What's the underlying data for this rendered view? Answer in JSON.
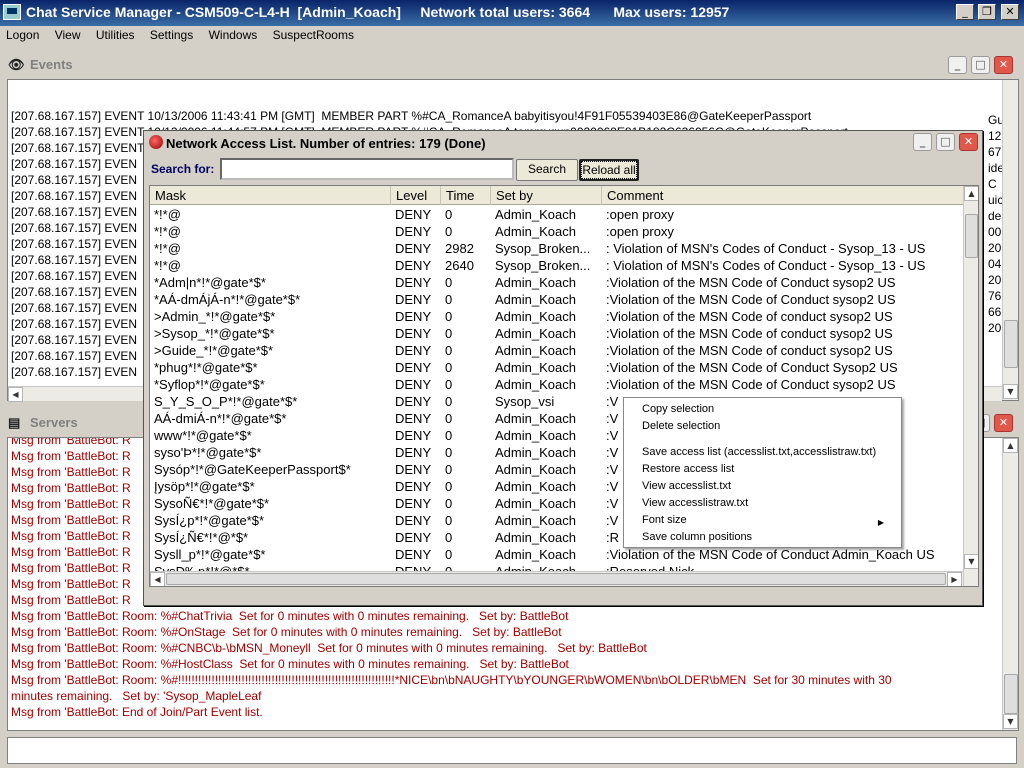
{
  "window": {
    "title": "Chat Service Manager - CSM509-C-L4-H  [Admin_Koach]     Network total users: 3664      Max users: 12957",
    "minimize": "_",
    "restore": "❐",
    "close": "✕"
  },
  "menu": [
    "Logon",
    "View",
    "Utilities",
    "Settings",
    "Windows",
    "SuspectRooms"
  ],
  "events": {
    "title": "Events",
    "lines": [
      "[207.68.167.157] EVENT 10/13/2006 11:43:41 PM [GMT]  MEMBER PART %#CA_RomanceA babyitisyou!4F91F05539403E86@GateKeeperPassport",
      "[207.68.167.157] EVENT 10/13/2006 11:44:57 PM [GMT]  MEMBER PART %#CA_RomanceA tommygun0020069E81B182C636056C@GateKeeperPassport",
      "[207.68.167.157] EVENT 10/13/2006 11:45:03 PM [GMT]  MEMBER MODE %#HelpDesk Saithan!07CFE50477AC12C6@GateKeeperPassport",
      "[207.68.167.157] EVEN",
      "[207.68.167.157] EVEN",
      "[207.68.167.157] EVEN",
      "[207.68.167.157] EVEN",
      "[207.68.167.157] EVEN",
      "[207.68.167.157] EVEN",
      "[207.68.167.157] EVEN",
      "[207.68.167.157] EVEN",
      "[207.68.167.157] EVEN",
      "[207.68.167.157] EVEN",
      "[207.68.167.157] EVEN",
      "[207.68.167.157] EVEN",
      "[207.68.167.157] EVEN",
      "[207.68.167.157] EVEN"
    ],
    "right_fragments": [
      "Guid",
      "12",
      "67",
      "ide",
      "C",
      "uic",
      "de",
      "00",
      "20",
      "04",
      "20",
      "761",
      "66",
      "20"
    ]
  },
  "servers": {
    "title": "Servers",
    "lines": [
      "Msg from 'BattleBot: R",
      "Msg from 'BattleBot: R",
      "Msg from 'BattleBot: R",
      "Msg from 'BattleBot: R",
      "Msg from 'BattleBot: R",
      "Msg from 'BattleBot: R",
      "Msg from 'BattleBot: R",
      "Msg from 'BattleBot: R",
      "Msg from 'BattleBot: R",
      "Msg from 'BattleBot: R",
      "Msg from 'BattleBot: R",
      "Msg from 'BattleBot: R",
      "Msg from 'BattleBot: R",
      "Msg from 'BattleBot: R",
      "Msg from 'BattleBot: R",
      "Msg from 'BattleBot: Room: %#ChatTrivia  Set for 0 minutes with 0 minutes remaining.   Set by: BattleBot",
      "Msg from 'BattleBot: Room: %#OnStage  Set for 0 minutes with 0 minutes remaining.   Set by: BattleBot",
      "Msg from 'BattleBot: Room: %#CNBC\\b-\\bMSN_Moneyll  Set for 0 minutes with 0 minutes remaining.   Set by: BattleBot",
      "Msg from 'BattleBot: Room: %#HostClass  Set for 0 minutes with 0 minutes remaining.   Set by: BattleBot",
      "Msg from 'BattleBot: Room: %#!!!!!!!!!!!!!!!!!!!!!!!!!!!!!!!!!!!!!!!!!!!!!!!!!!!!!!!!!!!!!!!!!*NICE\\bn\\bNAUGHTY\\bYOUNGER\\bWOMEN\\bn\\bOLDER\\bMEN  Set for 30 minutes with 30",
      "minutes remaining.   Set by: 'Sysop_MapleLeaf",
      "Msg from 'BattleBot: End of Join/Part Event list."
    ]
  },
  "dialog": {
    "title": "Network Access List. Number of entries: 179 (Done)",
    "search_label": "Search for:",
    "search_value": "",
    "search_button": "Search",
    "reload_button": "Reload all",
    "columns": [
      "Mask",
      "Level",
      "Time",
      "Set by",
      "Comment"
    ],
    "rows": [
      {
        "mask": "*!*@",
        "level": "DENY",
        "time": "0",
        "setby": "Admin_Koach",
        "comment": ":open proxy"
      },
      {
        "mask": "*!*@",
        "level": "DENY",
        "time": "0",
        "setby": "Admin_Koach",
        "comment": ":open proxy"
      },
      {
        "mask": "*!*@",
        "level": "DENY",
        "time": "2982",
        "setby": "Sysop_Broken...",
        "comment": ": Violation of MSN's Codes of Conduct - Sysop_13 - US"
      },
      {
        "mask": "*!*@",
        "level": "DENY",
        "time": "2640",
        "setby": "Sysop_Broken...",
        "comment": ": Violation of MSN's Codes of Conduct - Sysop_13 - US"
      },
      {
        "mask": "*Adm|n*!*@gate*$*",
        "level": "DENY",
        "time": "0",
        "setby": "Admin_Koach",
        "comment": ":Violation of the MSN Code of Conduct sysop2 US"
      },
      {
        "mask": "*AÁ-dmÁjÁ-n*!*@gate*$*",
        "level": "DENY",
        "time": "0",
        "setby": "Admin_Koach",
        "comment": ":Violation of the MSN Code of Conduct sysop2 US"
      },
      {
        "mask": ">Admin_*!*@gate*$*",
        "level": "DENY",
        "time": "0",
        "setby": "Admin_Koach",
        "comment": ":Violation of the MSN Code of conduct sysop2 US"
      },
      {
        "mask": ">Sysop_*!*@gate*$*",
        "level": "DENY",
        "time": "0",
        "setby": "Admin_Koach",
        "comment": ":Violation of the MSN Code of conduct sysop2 US"
      },
      {
        "mask": ">Guide_*!*@gate*$*",
        "level": "DENY",
        "time": "0",
        "setby": "Admin_Koach",
        "comment": ":Violation of the MSN Code of conduct sysop2 US"
      },
      {
        "mask": "*phug*!*@gate*$*",
        "level": "DENY",
        "time": "0",
        "setby": "Admin_Koach",
        "comment": ":Violation of the MSN Code of Conduct Sysop2 US"
      },
      {
        "mask": "*Syflop*!*@gate*$*",
        "level": "DENY",
        "time": "0",
        "setby": "Admin_Koach",
        "comment": ":Violation of the MSN Code of Conduct sysop2 US"
      },
      {
        "mask": "S_Y_S_O_P*!*@gate*$*",
        "level": "DENY",
        "time": "0",
        "setby": "Sysop_vsi",
        "comment": ":V"
      },
      {
        "mask": "AÁ-dmiÁ-n*!*@gate*$*",
        "level": "DENY",
        "time": "0",
        "setby": "Admin_Koach",
        "comment": ":V"
      },
      {
        "mask": "www*!*@gate*$*",
        "level": "DENY",
        "time": "0",
        "setby": "Admin_Koach",
        "comment": ":V"
      },
      {
        "mask": "syso'Þ*!*@gate*$*",
        "level": "DENY",
        "time": "0",
        "setby": "Admin_Koach",
        "comment": ":V"
      },
      {
        "mask": "Sysóp*!*@GateKeeperPassport$*",
        "level": "DENY",
        "time": "0",
        "setby": "Admin_Koach",
        "comment": ":V"
      },
      {
        "mask": "Įysöp*!*@gate*$*",
        "level": "DENY",
        "time": "0",
        "setby": "Admin_Koach",
        "comment": ":V"
      },
      {
        "mask": "SysoÑ€*!*@gate*$*",
        "level": "DENY",
        "time": "0",
        "setby": "Admin_Koach",
        "comment": ":V"
      },
      {
        "mask": "SysÍ¿p*!*@gate*$*",
        "level": "DENY",
        "time": "0",
        "setby": "Admin_Koach",
        "comment": ":V"
      },
      {
        "mask": "SysÍ¿Ñ€*!*@*$*",
        "level": "DENY",
        "time": "0",
        "setby": "Admin_Koach",
        "comment": ":R"
      },
      {
        "mask": "Sysll_p*!*@gate*$*",
        "level": "DENY",
        "time": "0",
        "setby": "Admin_Koach",
        "comment": ":Violation of the MSN Code of Conduct Admin_Koach US"
      },
      {
        "mask": "SysÐ‰p*!*@*$*",
        "level": "DENY",
        "time": "0",
        "setby": "Admin_Koach",
        "comment": ":Reserved Nick"
      },
      {
        "mask": "SysÐ‰Ñ€*!*@*$*",
        "level": "DENY",
        "time": "0",
        "setby": "Admin_Koach",
        "comment": ":Violation of MSN Code Of Conduct"
      }
    ],
    "row_tail_fragments": [
      ": allowed",
      "S",
      "S",
      "S"
    ]
  },
  "context_menu": {
    "items": [
      {
        "label": "Copy selection",
        "group": 0
      },
      {
        "label": "Delete selection",
        "group": 0
      },
      {
        "label": "Save access list (accesslist.txt,accesslistraw.txt)",
        "group": 1
      },
      {
        "label": "Restore access list",
        "group": 1
      },
      {
        "label": "View accesslist.txt",
        "group": 1
      },
      {
        "label": "View accesslistraw.txt",
        "group": 1
      },
      {
        "label": "Font size",
        "group": 1,
        "submenu": true
      },
      {
        "label": "Save column positions",
        "group": 1
      }
    ],
    "submenu_arrow": "▶"
  },
  "command_input": {
    "value": ""
  }
}
